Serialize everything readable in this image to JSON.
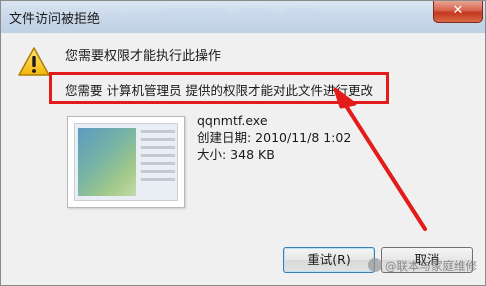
{
  "window": {
    "title": "文件访问被拒绝",
    "close_label": "✕"
  },
  "dialog": {
    "heading": "您需要权限才能执行此操作",
    "detail": "您需要 计算机管理员 提供的权限才能对此文件进行更改"
  },
  "file": {
    "name": "qqnmtf.exe",
    "created": "创建日期: 2010/11/8 1:02",
    "size": "大小: 348 KB"
  },
  "buttons": {
    "retry": "重试(R)",
    "cancel": "取消"
  },
  "watermark": {
    "text": "@联本与家庭维修"
  },
  "colors": {
    "highlight": "#e31b1b",
    "titlebar": "#c9d8ea",
    "close_button": "#c4361d"
  },
  "icons": {
    "warning": "warning-triangle-icon",
    "file": "exe-file-thumbnail-icon",
    "close": "close-icon"
  }
}
